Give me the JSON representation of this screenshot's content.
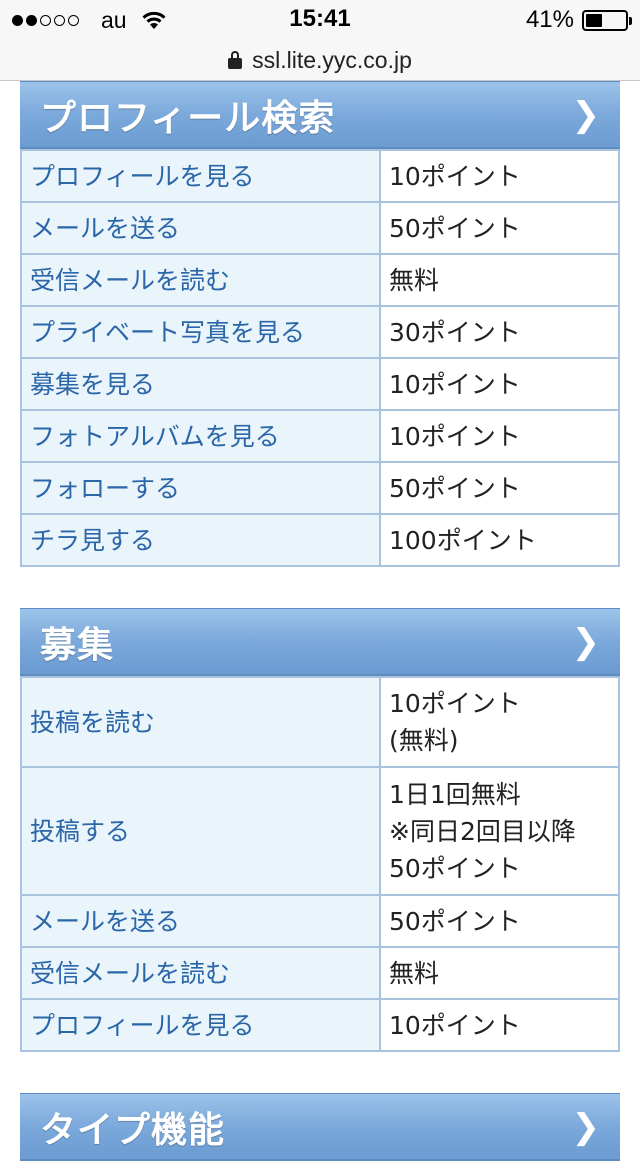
{
  "status_bar": {
    "carrier": "au",
    "time": "15:41",
    "battery": "41%",
    "signal_bars": 2,
    "battery_level": 0.41
  },
  "url_bar": {
    "url": "ssl.lite.yyc.co.jp"
  },
  "sections": [
    {
      "title": "プロフィール検索",
      "rows": [
        {
          "label": "プロフィールを見る",
          "value": "10ポイント"
        },
        {
          "label": "メールを送る",
          "value": "50ポイント"
        },
        {
          "label": "受信メールを読む",
          "value": "無料"
        },
        {
          "label": "プライベート写真を見る",
          "value": "30ポイント"
        },
        {
          "label": "募集を見る",
          "value": "10ポイント"
        },
        {
          "label": "フォトアルバムを見る",
          "value": "10ポイント"
        },
        {
          "label": "フォローする",
          "value": "50ポイント"
        },
        {
          "label": "チラ見する",
          "value": "100ポイント"
        }
      ]
    },
    {
      "title": "募集",
      "rows": [
        {
          "label": "投稿を読む",
          "value_lines": [
            "10ポイント",
            "(無料)"
          ]
        },
        {
          "label": "投稿する",
          "value_lines": [
            "1日1回無料",
            "※同日2回目以降",
            "50ポイント"
          ]
        },
        {
          "label": "メールを送る",
          "value_lines": [
            "50ポイント"
          ]
        },
        {
          "label": "受信メールを読む",
          "value_lines": [
            "無料"
          ]
        },
        {
          "label": "プロフィールを見る",
          "value_lines": [
            "10ポイント"
          ]
        }
      ]
    },
    {
      "title": "タイプ機能"
    }
  ],
  "icons": {
    "chevron": "chevron-right-icon",
    "lock": "lock-icon",
    "wifi": "wifi-icon",
    "battery": "battery-icon"
  }
}
